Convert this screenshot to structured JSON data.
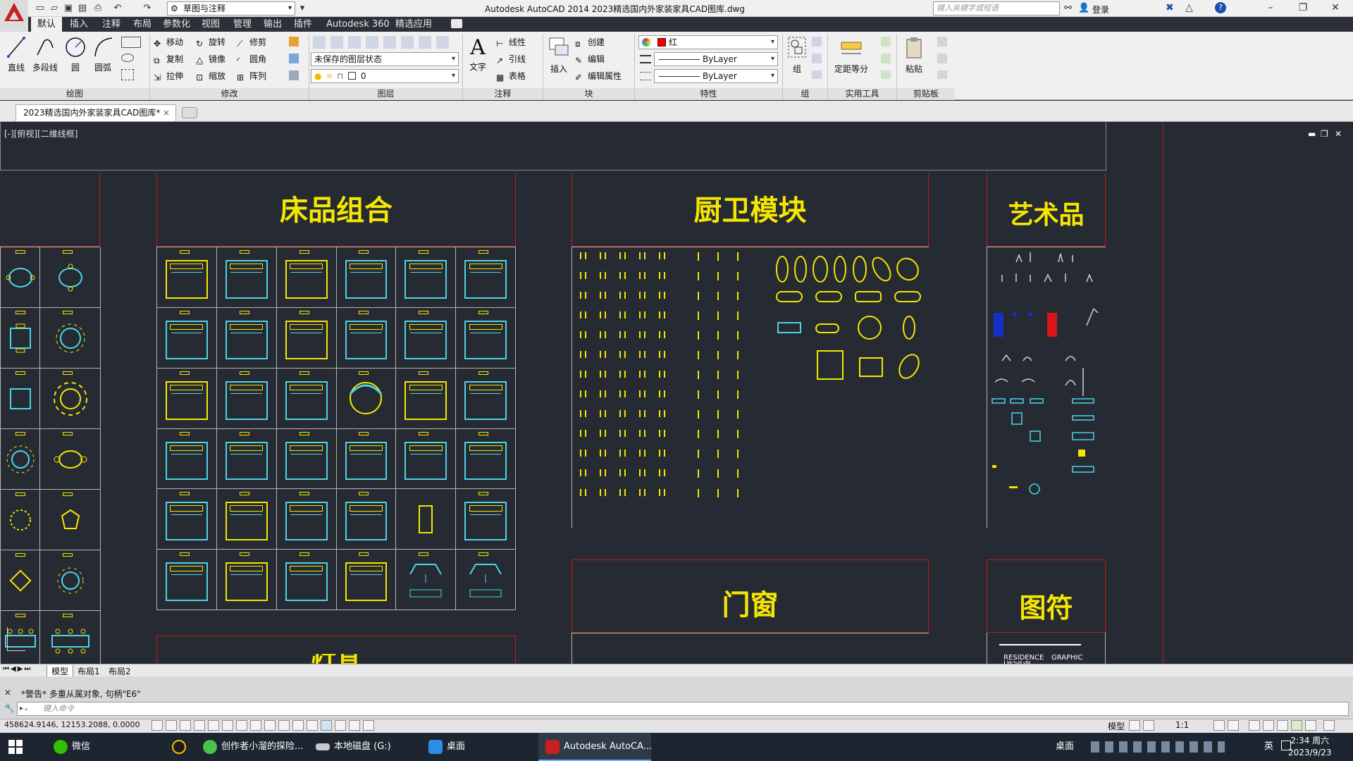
{
  "titlebar": {
    "workspace": "草图与注释",
    "title": "Autodesk AutoCAD 2014    2023精选国内外家装家具CAD图库.dwg",
    "search_placeholder": "键入关键字或短语",
    "login": "登录"
  },
  "ribbon_tabs": [
    "默认",
    "插入",
    "注释",
    "布局",
    "参数化",
    "视图",
    "管理",
    "输出",
    "插件",
    "Autodesk 360",
    "精选应用"
  ],
  "ribbon": {
    "draw": {
      "line": "直线",
      "polyline": "多段线",
      "circle": "圆",
      "arc": "圆弧"
    },
    "modify": {
      "move": "移动",
      "rotate": "旋转",
      "trim": "修剪",
      "copy": "复制",
      "mirror": "镜像",
      "fillet": "圆角",
      "stretch": "拉伸",
      "scale": "缩放",
      "array": "阵列"
    },
    "layers": {
      "state": "未保存的图层状态",
      "current": "0"
    },
    "annotation": {
      "text": "文字",
      "linear": "线性",
      "leader": "引线",
      "table": "表格"
    },
    "block": {
      "insert": "插入",
      "create": "创建",
      "edit": "编辑",
      "edit_attr": "编辑属性"
    },
    "properties": {
      "color": "红",
      "linetype": "ByLayer",
      "lineweight": "ByLayer"
    },
    "group_btn": "组",
    "utilities": {
      "measure": "定距等分"
    },
    "clipboard": {
      "paste": "粘贴"
    },
    "panels": [
      "绘图",
      "修改",
      "图层",
      "注释",
      "块",
      "特性",
      "组",
      "实用工具",
      "剪贴板"
    ]
  },
  "doc_tab": "2023精选国内外家装家具CAD图库*",
  "viewport_label": "[-][俯视][二维线框]",
  "drawing": {
    "headers": {
      "bedding": "床品组合",
      "kitchen_bath": "厨卫模块",
      "art": "艺术品",
      "doors": "门窗",
      "symbols": "图符",
      "lamps": "灯具"
    },
    "symbol_text": {
      "residence": "RESIDENCE",
      "graphic": "GRAPHIC",
      "design": "DESIGN"
    }
  },
  "layout_tabs": [
    "模型",
    "布局1",
    "布局2"
  ],
  "command": {
    "history": "*警告* 多重从属对象, 句柄\"E6\"",
    "placeholder": "键入命令"
  },
  "status": {
    "coords": "458624.9146, 12153.2088, 0.0000",
    "model": "模型",
    "scale": "1:1"
  },
  "taskbar": {
    "items": [
      "微信",
      "创作者小溜的探险...",
      "本地磁盘 (G:)",
      "桌面",
      "Autodesk AutoCA..."
    ],
    "tray_label": "桌面",
    "ime": "英",
    "time": "2:34 周六",
    "date": "2023/9/23"
  },
  "colors": {
    "accent_red": "#c51a1a",
    "cad_yellow": "#f5e600",
    "cad_cyan": "#4fd3e6",
    "canvas": "#252a33"
  }
}
